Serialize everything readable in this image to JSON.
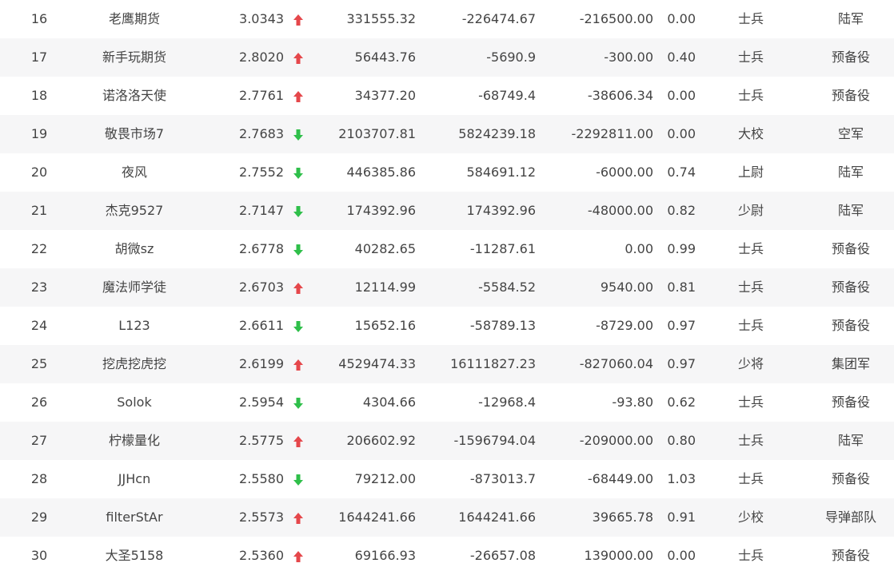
{
  "colors": {
    "up": "#e5474b",
    "down": "#2fbf4a",
    "row_alt": "#f6f6f7",
    "text": "#444444"
  },
  "rows": [
    {
      "rank": "16",
      "name": "老鹰期货",
      "score": "3.0343",
      "trend": "up",
      "trend_icon": "arrow-up-icon",
      "v1": "331555.32",
      "v2": "-226474.67",
      "v3": "-216500.00",
      "v4": "0.00",
      "rank_title": "士兵",
      "branch": "陆军"
    },
    {
      "rank": "17",
      "name": "新手玩期货",
      "score": "2.8020",
      "trend": "up",
      "trend_icon": "arrow-up-icon",
      "v1": "56443.76",
      "v2": "-5690.9",
      "v3": "-300.00",
      "v4": "0.40",
      "rank_title": "士兵",
      "branch": "预备役"
    },
    {
      "rank": "18",
      "name": "诺洛洛天使",
      "score": "2.7761",
      "trend": "up",
      "trend_icon": "arrow-up-icon",
      "v1": "34377.20",
      "v2": "-68749.4",
      "v3": "-38606.34",
      "v4": "0.00",
      "rank_title": "士兵",
      "branch": "预备役"
    },
    {
      "rank": "19",
      "name": "敬畏市场7",
      "score": "2.7683",
      "trend": "down",
      "trend_icon": "arrow-down-icon",
      "v1": "2103707.81",
      "v2": "5824239.18",
      "v3": "-2292811.00",
      "v4": "0.00",
      "rank_title": "大校",
      "branch": "空军"
    },
    {
      "rank": "20",
      "name": "夜风",
      "score": "2.7552",
      "trend": "down",
      "trend_icon": "arrow-down-icon",
      "v1": "446385.86",
      "v2": "584691.12",
      "v3": "-6000.00",
      "v4": "0.74",
      "rank_title": "上尉",
      "branch": "陆军"
    },
    {
      "rank": "21",
      "name": "杰克9527",
      "score": "2.7147",
      "trend": "down",
      "trend_icon": "arrow-down-icon",
      "v1": "174392.96",
      "v2": "174392.96",
      "v3": "-48000.00",
      "v4": "0.82",
      "rank_title": "少尉",
      "branch": "陆军"
    },
    {
      "rank": "22",
      "name": "胡微sz",
      "score": "2.6778",
      "trend": "down",
      "trend_icon": "arrow-down-icon",
      "v1": "40282.65",
      "v2": "-11287.61",
      "v3": "0.00",
      "v4": "0.99",
      "rank_title": "士兵",
      "branch": "预备役"
    },
    {
      "rank": "23",
      "name": "魔法师学徒",
      "score": "2.6703",
      "trend": "up",
      "trend_icon": "arrow-up-icon",
      "v1": "12114.99",
      "v2": "-5584.52",
      "v3": "9540.00",
      "v4": "0.81",
      "rank_title": "士兵",
      "branch": "预备役"
    },
    {
      "rank": "24",
      "name": "L123",
      "score": "2.6611",
      "trend": "down",
      "trend_icon": "arrow-down-icon",
      "v1": "15652.16",
      "v2": "-58789.13",
      "v3": "-8729.00",
      "v4": "0.97",
      "rank_title": "士兵",
      "branch": "预备役"
    },
    {
      "rank": "25",
      "name": "挖虎挖虎挖",
      "score": "2.6199",
      "trend": "up",
      "trend_icon": "arrow-up-icon",
      "v1": "4529474.33",
      "v2": "16111827.23",
      "v3": "-827060.04",
      "v4": "0.97",
      "rank_title": "少将",
      "branch": "集团军"
    },
    {
      "rank": "26",
      "name": "Solok",
      "score": "2.5954",
      "trend": "down",
      "trend_icon": "arrow-down-icon",
      "v1": "4304.66",
      "v2": "-12968.4",
      "v3": "-93.80",
      "v4": "0.62",
      "rank_title": "士兵",
      "branch": "预备役"
    },
    {
      "rank": "27",
      "name": "柠檬量化",
      "score": "2.5775",
      "trend": "up",
      "trend_icon": "arrow-up-icon",
      "v1": "206602.92",
      "v2": "-1596794.04",
      "v3": "-209000.00",
      "v4": "0.80",
      "rank_title": "士兵",
      "branch": "陆军"
    },
    {
      "rank": "28",
      "name": "JJHcn",
      "score": "2.5580",
      "trend": "down",
      "trend_icon": "arrow-down-icon",
      "v1": "79212.00",
      "v2": "-873013.7",
      "v3": "-68449.00",
      "v4": "1.03",
      "rank_title": "士兵",
      "branch": "预备役"
    },
    {
      "rank": "29",
      "name": "filterStAr",
      "score": "2.5573",
      "trend": "up",
      "trend_icon": "arrow-up-icon",
      "v1": "1644241.66",
      "v2": "1644241.66",
      "v3": "39665.78",
      "v4": "0.91",
      "rank_title": "少校",
      "branch": "导弹部队"
    },
    {
      "rank": "30",
      "name": "大圣5158",
      "score": "2.5360",
      "trend": "up",
      "trend_icon": "arrow-up-icon",
      "v1": "69166.93",
      "v2": "-26657.08",
      "v3": "139000.00",
      "v4": "0.00",
      "rank_title": "士兵",
      "branch": "预备役"
    }
  ]
}
